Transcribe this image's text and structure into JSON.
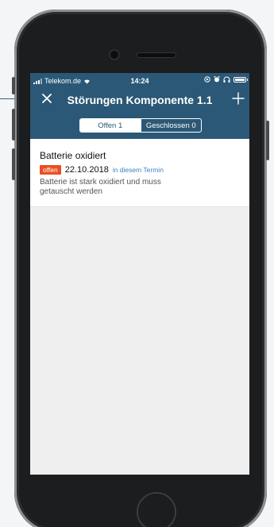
{
  "status_bar": {
    "carrier": "Telekom.de",
    "time": "14:24"
  },
  "nav": {
    "title": "Störungen Komponente 1.1"
  },
  "segments": {
    "open_label": "Offen 1",
    "closed_label": "Geschlossen 0",
    "selected": "open"
  },
  "issues": [
    {
      "title": "Batterie oxidiert",
      "status": "offen",
      "date": "22.10.2018",
      "link": "in diesem Termin",
      "description": "Batterie ist stark oxidiert und muss getauscht werden"
    }
  ],
  "colors": {
    "header": "#2b5876",
    "badge": "#e8501f",
    "link": "#3a84c1"
  },
  "icons": {
    "close": "close-icon",
    "add": "plus-icon",
    "wifi": "wifi-icon",
    "battery": "battery-icon"
  }
}
